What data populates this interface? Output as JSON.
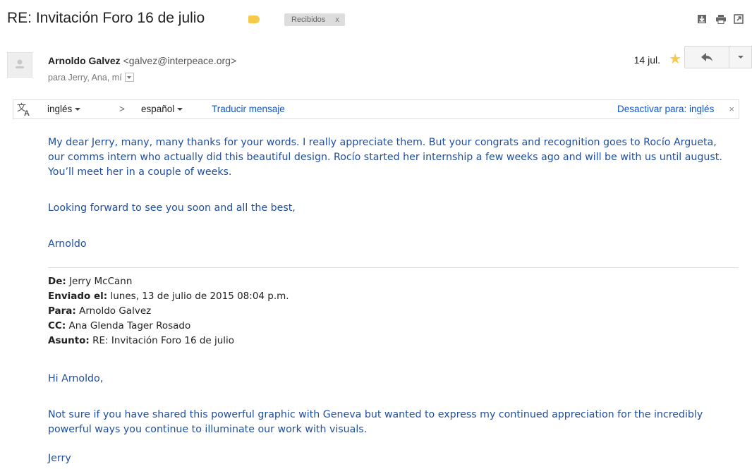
{
  "subject": "RE: Invitación Foro 16 de julio",
  "label_chip": {
    "text": "Recibidos",
    "close": "x"
  },
  "colors": {
    "label_tag": "#f6c94b",
    "star": "#f6c94b",
    "body_text": "#1f4e9e",
    "link": "#1155cc"
  },
  "toolbar_icons": [
    "download-icon",
    "print-icon",
    "open-in-new-window-icon"
  ],
  "sender": {
    "name": "Arnoldo Galvez",
    "email": "<galvez@interpeace.org>",
    "recipients": "para Jerry, Ana, mí",
    "date": "14 jul.",
    "starred": true
  },
  "translate": {
    "source_lang": "inglés",
    "arrow": ">",
    "target_lang": "español",
    "translate_link": "Traducir mensaje",
    "disable_link": "Desactivar para: inglés",
    "close": "×"
  },
  "reply": {
    "paragraphs": [
      "My dear Jerry, many, many thanks for your words. I really appreciate them. But your congrats and recognition goes to Rocío Argueta, our comms intern who actually did this beautiful design. Rocío started her internship a few weeks ago and will be with us until august. You’ll meet her in a couple of weeks.",
      "Looking forward to see you soon and all the best,",
      "Arnoldo"
    ]
  },
  "quoted_header": {
    "from_label": "De:",
    "from": "Jerry McCann",
    "sent_label": "Enviado el:",
    "sent": "lunes, 13 de julio de 2015 08:04 p.m.",
    "to_label": "Para:",
    "to": "Arnoldo Galvez",
    "cc_label": "CC:",
    "cc": "Ana Glenda Tager Rosado",
    "subject_label": "Asunto:",
    "subject": "RE: Invitación Foro 16 de julio"
  },
  "quoted_body": {
    "greeting": "Hi Arnoldo,",
    "paragraph": "Not sure if you have shared this powerful graphic with Geneva but wanted to express my continued appreciation for the incredibly powerful ways you continue to illuminate our work with visuals.",
    "signature": "Jerry"
  }
}
